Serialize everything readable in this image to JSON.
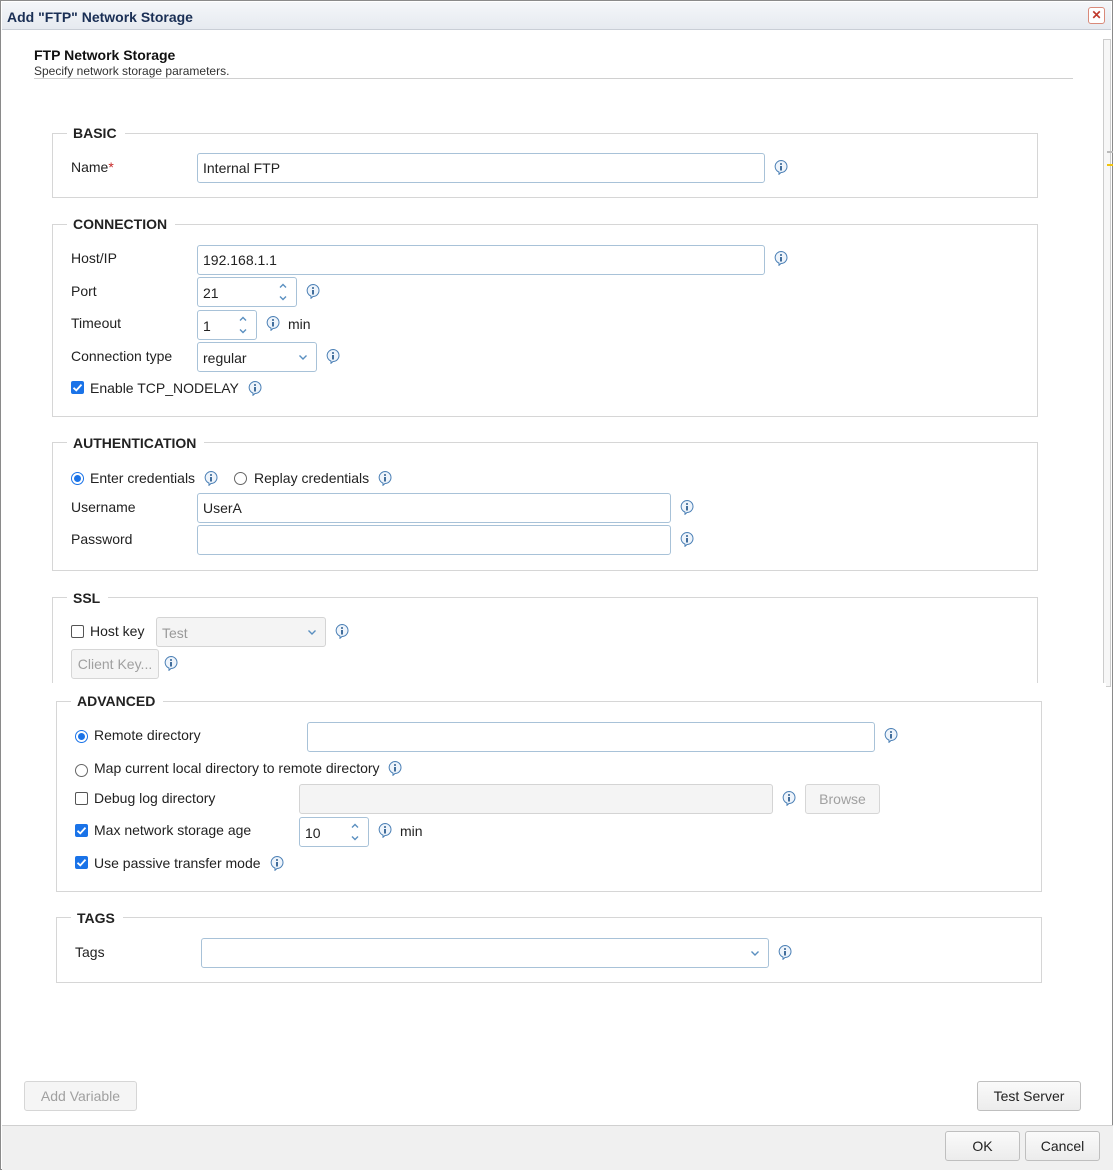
{
  "window": {
    "title": "Add \"FTP\" Network Storage",
    "close_glyph": "✕"
  },
  "header": {
    "title": "FTP Network Storage",
    "subtitle": "Specify network storage parameters."
  },
  "basic": {
    "legend": "BASIC",
    "name_label": "Name",
    "required_mark": "*",
    "name_value": "Internal FTP"
  },
  "connection": {
    "legend": "CONNECTION",
    "host_label": "Host/IP",
    "host_value": "192.168.1.1",
    "port_label": "Port",
    "port_value": "21",
    "timeout_label": "Timeout",
    "timeout_value": "1",
    "timeout_unit": "min",
    "type_label": "Connection type",
    "type_value": "regular",
    "nodelay_label": "Enable TCP_NODELAY",
    "nodelay_checked": true
  },
  "authentication": {
    "legend": "AUTHENTICATION",
    "enter_label": "Enter credentials",
    "replay_label": "Replay credentials",
    "selected": "enter",
    "username_label": "Username",
    "username_value": "UserA",
    "password_label": "Password",
    "password_value": ""
  },
  "ssl": {
    "legend": "SSL",
    "hostkey_label": "Host key",
    "hostkey_checked": false,
    "hostkey_value": "Test",
    "client_key_label": "Client Key..."
  },
  "advanced": {
    "legend": "ADVANCED",
    "remote_dir_label": "Remote directory",
    "remote_dir_value": "",
    "map_label": "Map current local directory to remote directory",
    "selected": "remote",
    "debug_label": "Debug log directory",
    "debug_checked": false,
    "debug_value": "",
    "browse_label": "Browse",
    "max_age_label": "Max network storage age",
    "max_age_checked": true,
    "max_age_value": "10",
    "max_age_unit": "min",
    "passive_label": "Use passive transfer mode",
    "passive_checked": true
  },
  "tags": {
    "legend": "TAGS",
    "tags_label": "Tags",
    "tags_value": ""
  },
  "buttons": {
    "add_variable": "Add Variable",
    "test_server": "Test Server",
    "ok": "OK",
    "cancel": "Cancel"
  },
  "colors": {
    "accent": "#1a73e8",
    "required": "#c62828",
    "input_border": "#a8c2d8"
  }
}
